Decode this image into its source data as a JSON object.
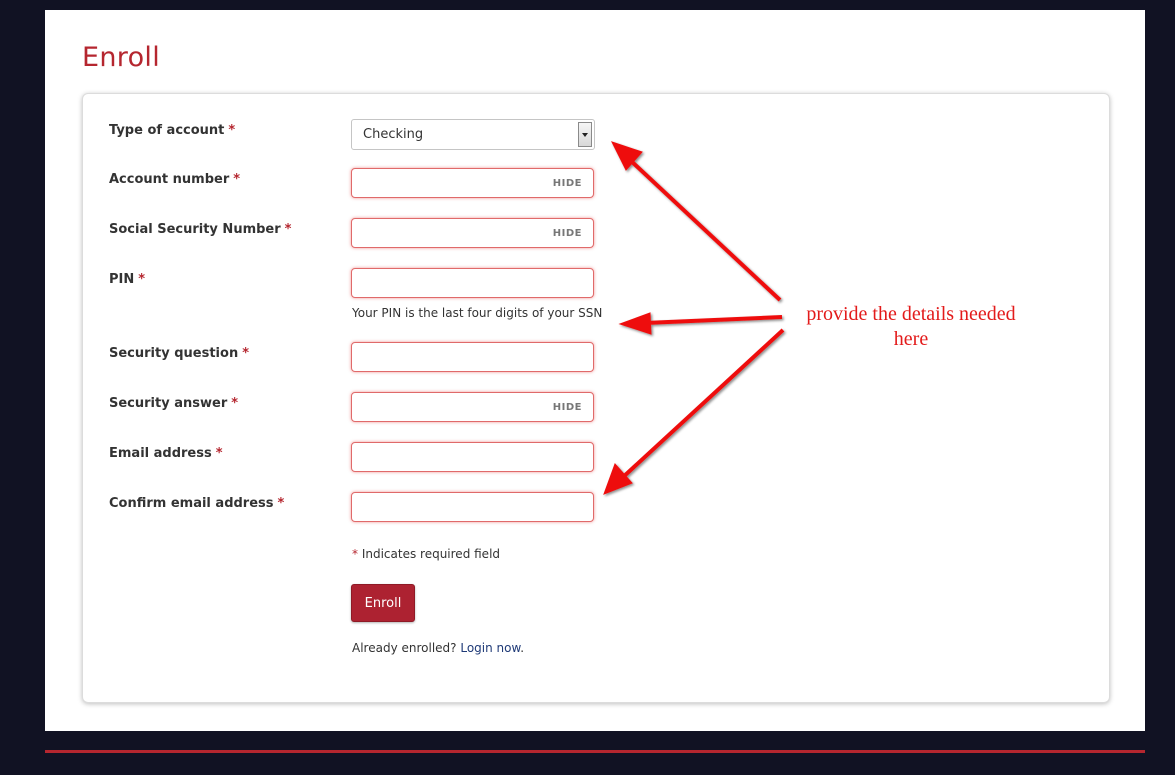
{
  "page": {
    "title": "Enroll",
    "accent_color": "#b5262f",
    "background_color": "#111223"
  },
  "form": {
    "required_marker": "*",
    "fields": {
      "account_type": {
        "label": "Type of account",
        "value": "Checking"
      },
      "account_number": {
        "label": "Account number",
        "toggle_label": "HIDE"
      },
      "ssn": {
        "label": "Social Security Number",
        "toggle_label": "HIDE"
      },
      "pin": {
        "label": "PIN",
        "hint": "Your PIN is the last four digits of your SSN"
      },
      "security_question": {
        "label": "Security question"
      },
      "security_answer": {
        "label": "Security answer",
        "toggle_label": "HIDE"
      },
      "email": {
        "label": "Email address"
      },
      "confirm_email": {
        "label": "Confirm email address"
      }
    },
    "required_note": "Indicates required field",
    "submit_label": "Enroll",
    "already_enrolled_text": "Already enrolled?",
    "login_link_label": "Login now",
    "login_suffix": "."
  },
  "annotation": {
    "line1": "provide the details needed",
    "line2": "here",
    "color": "#e31b1b"
  }
}
